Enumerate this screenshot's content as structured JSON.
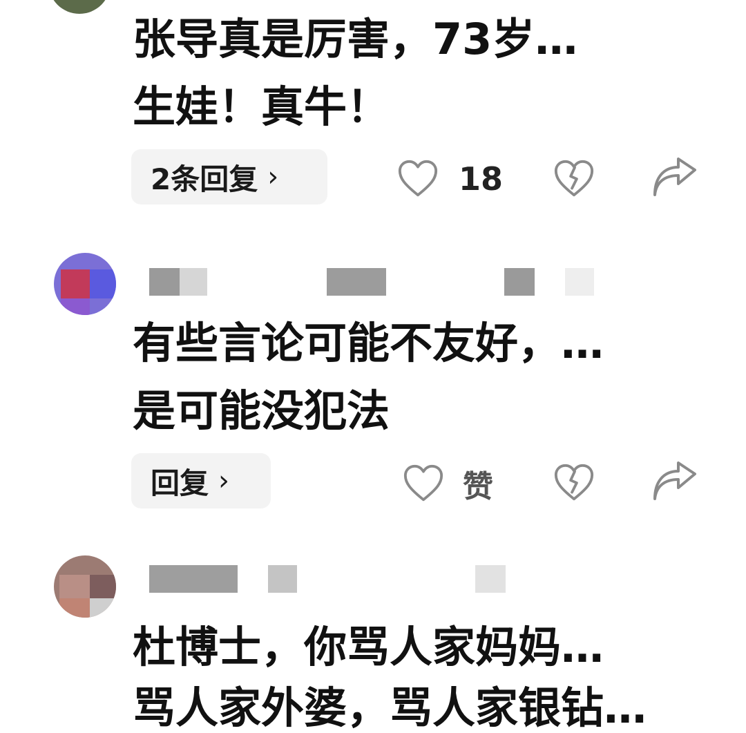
{
  "comments": [
    {
      "line1": "张导真是厉害，73岁…",
      "line2": "生娃！真牛！",
      "reply_label": "2条回复",
      "like_count": "18"
    },
    {
      "line1": "有些言论可能不友好，…",
      "line2": "是可能没犯法",
      "reply_label": "回复",
      "like_label": "赞"
    },
    {
      "line1": "杜博士，你骂人家妈妈…",
      "line2": "骂人家外婆，骂人家银钻…"
    }
  ],
  "icons": {
    "reply_chevron": "chevron-right-icon",
    "like": "heart-outline-icon",
    "dislike": "broken-heart-icon",
    "share": "share-arrow-icon"
  },
  "colors": {
    "text": "#111111",
    "chip_bg": "#f3f3f3",
    "icon": "#8a8a8a"
  }
}
